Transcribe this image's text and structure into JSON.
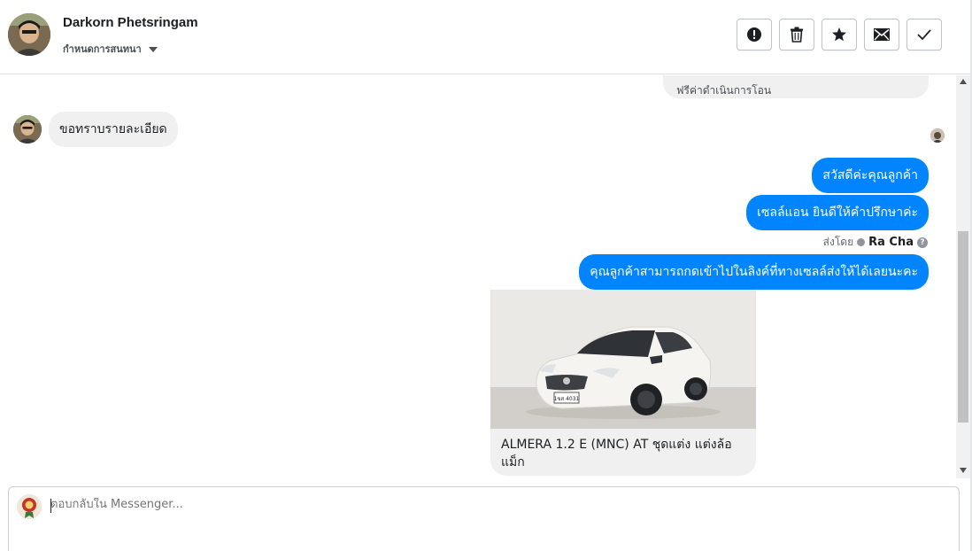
{
  "header": {
    "contact_name": "Darkorn Phetsringam",
    "subtitle": "กำหนดการสนทนา",
    "actions": [
      {
        "name": "mark-spam-button",
        "icon": "alert-icon"
      },
      {
        "name": "delete-button",
        "icon": "trash-icon"
      },
      {
        "name": "star-button",
        "icon": "star-icon"
      },
      {
        "name": "mark-unread-button",
        "icon": "envelope-icon"
      },
      {
        "name": "mark-done-button",
        "icon": "check-icon"
      }
    ]
  },
  "messages": {
    "outgoing_partial": "ฟรีค่าดำเนินการโอน",
    "incoming_1": "ขอทราบรายละเอียด",
    "outgoing_1": "สวัสดีค่ะคุณลูกค้า",
    "outgoing_2": "เซลล์แอน ยินดีให้คำปรึกษาค่ะ",
    "sent_by_label": "ส่งโดย",
    "sent_by_agent": "Ra Cha",
    "help_glyph": "?",
    "outgoing_3": "คุณลูกค้าสามารถกดเข้าไปในลิงค์ที่ทางเซลล์ส่งให้ได้เลยนะคะ",
    "link_card_title": "ALMERA 1.2 E (MNC) AT ชุดแต่ง แต่งล้อแม็ก",
    "plate_text": "1ขส 4031"
  },
  "composer": {
    "placeholder": "ตอบกลับใน Messenger..."
  },
  "colors": {
    "outgoing_bubble": "#0084ff",
    "incoming_bubble": "#f0f0f0",
    "scroll_thumb": "#c1c1c1"
  }
}
